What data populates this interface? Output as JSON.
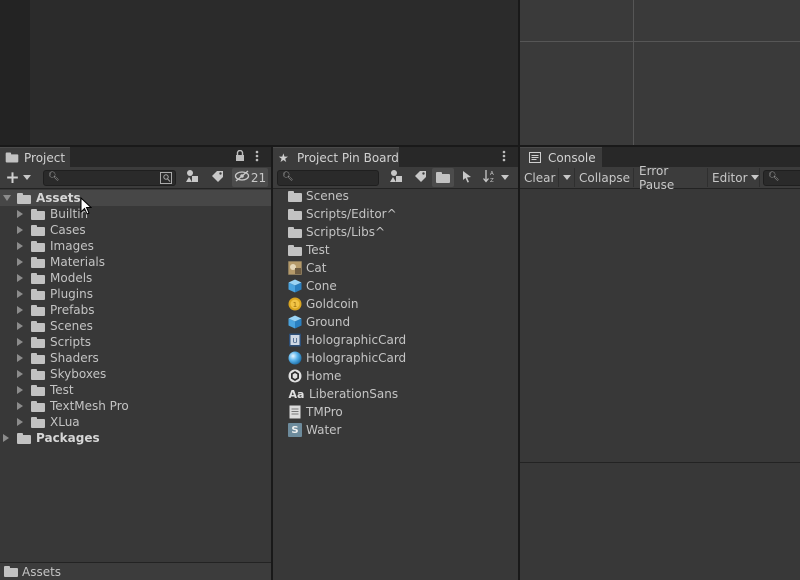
{
  "project_panel": {
    "tab_label": "Project",
    "lock_icon": "lock-icon",
    "menu_icon": "kebab-menu-icon",
    "add_button": "+",
    "hidden_count": "21",
    "tree": [
      {
        "label": "Assets",
        "level": 0,
        "expanded": true,
        "selected": true,
        "bold": true
      },
      {
        "label": "Builtin",
        "level": 1
      },
      {
        "label": "Cases",
        "level": 1
      },
      {
        "label": "Images",
        "level": 1
      },
      {
        "label": "Materials",
        "level": 1
      },
      {
        "label": "Models",
        "level": 1
      },
      {
        "label": "Plugins",
        "level": 1
      },
      {
        "label": "Prefabs",
        "level": 1
      },
      {
        "label": "Scenes",
        "level": 1
      },
      {
        "label": "Scripts",
        "level": 1
      },
      {
        "label": "Shaders",
        "level": 1
      },
      {
        "label": "Skyboxes",
        "level": 1
      },
      {
        "label": "Test",
        "level": 1
      },
      {
        "label": "TextMesh Pro",
        "level": 1
      },
      {
        "label": "XLua",
        "level": 1
      },
      {
        "label": "Packages",
        "level": 0,
        "bold": true
      }
    ],
    "footer_path": "Assets"
  },
  "pinboard_panel": {
    "tab_label": "Project Pin Board",
    "items": [
      {
        "label": "Scenes",
        "icon": "folder-icon"
      },
      {
        "label": "Scripts/Editor^",
        "icon": "folder-icon"
      },
      {
        "label": "Scripts/Libs^",
        "icon": "folder-icon"
      },
      {
        "label": "Test",
        "icon": "folder-icon"
      },
      {
        "label": "Cat",
        "icon": "texture-icon"
      },
      {
        "label": "Cone",
        "icon": "prefab-cube-icon"
      },
      {
        "label": "Goldcoin",
        "icon": "coin-icon"
      },
      {
        "label": "Ground",
        "icon": "prefab-cube-icon"
      },
      {
        "label": "HolographicCard",
        "icon": "shader-icon"
      },
      {
        "label": "HolographicCard",
        "icon": "material-sphere-icon"
      },
      {
        "label": "Home",
        "icon": "unity-scene-icon"
      },
      {
        "label": "LiberationSans",
        "icon": "font-icon"
      },
      {
        "label": "TMPro",
        "icon": "text-document-icon"
      },
      {
        "label": "Water",
        "icon": "script-icon"
      }
    ]
  },
  "console_panel": {
    "tab_label": "Console",
    "clear_label": "Clear",
    "collapse_label": "Collapse",
    "error_pause_label": "Error Pause",
    "editor_label": "Editor"
  },
  "font_icon_text": "Aa",
  "script_icon_text": "S"
}
